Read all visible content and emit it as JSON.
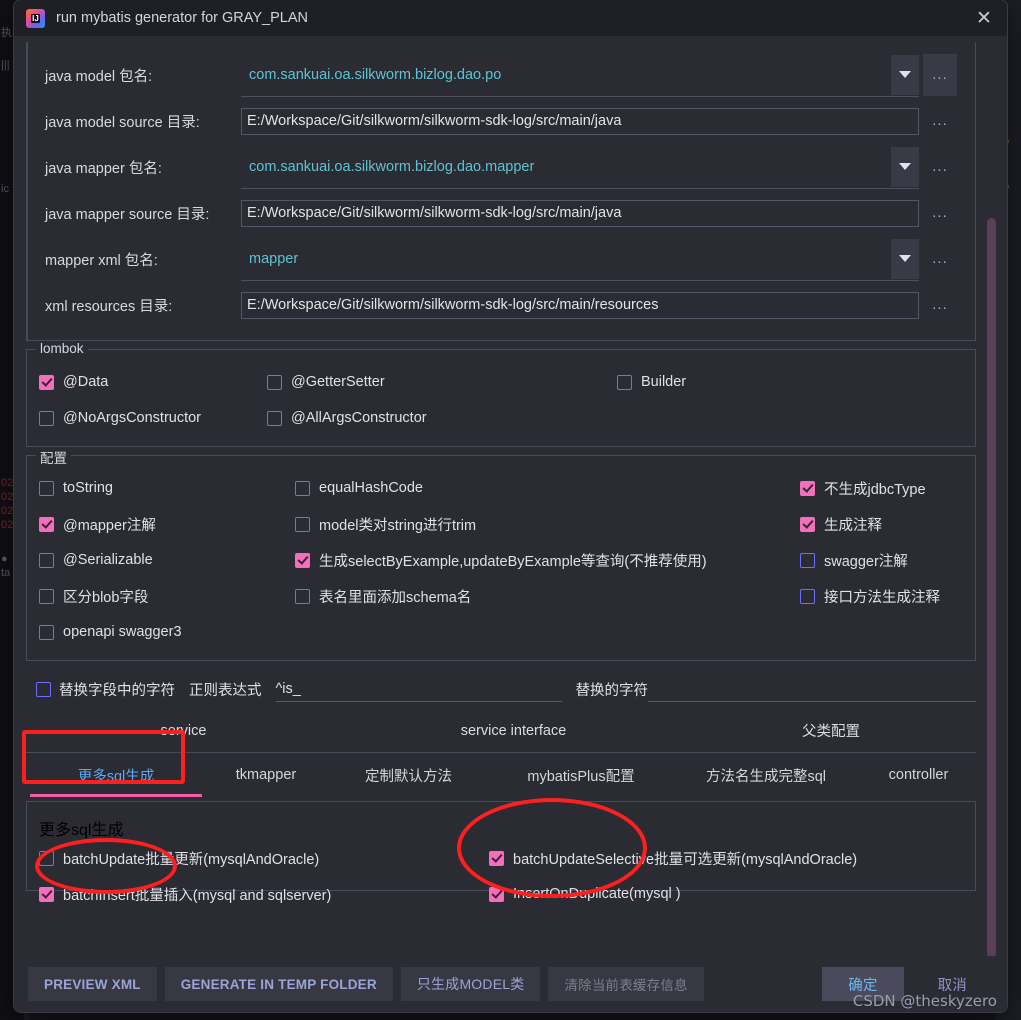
{
  "window": {
    "title": "run mybatis generator for GRAY_PLAN",
    "close_label": "✕",
    "app_icon": "intellij-idea-icon"
  },
  "paths": {
    "rows": [
      {
        "label": "java model 包名:",
        "type": "combo",
        "value": "com.sankuai.oa.silkworm.bizlog.dao.po",
        "browse": "..."
      },
      {
        "label": "java model source 目录:",
        "type": "text",
        "value": "E:/Workspace/Git/silkworm/silkworm-sdk-log/src/main/java",
        "browse": "..."
      },
      {
        "label": "java mapper 包名:",
        "type": "combo",
        "value": "com.sankuai.oa.silkworm.bizlog.dao.mapper",
        "browse": "..."
      },
      {
        "label": "java mapper source 目录:",
        "type": "text",
        "value": "E:/Workspace/Git/silkworm/silkworm-sdk-log/src/main/java",
        "browse": "..."
      },
      {
        "label": "mapper xml 包名:",
        "type": "combo",
        "value": "mapper",
        "browse": "..."
      },
      {
        "label": "xml resources 目录:",
        "type": "text",
        "value": "E:/Workspace/Git/silkworm/silkworm-sdk-log/src/main/resources",
        "browse": "..."
      }
    ]
  },
  "lombok": {
    "legend": "lombok",
    "items": [
      {
        "label": "@Data",
        "checked": true
      },
      {
        "label": "@GetterSetter",
        "checked": false
      },
      {
        "label": "Builder",
        "checked": false
      },
      {
        "label": "@NoArgsConstructor",
        "checked": false
      },
      {
        "label": "@AllArgsConstructor",
        "checked": false
      }
    ]
  },
  "config": {
    "legend": "配置",
    "items": [
      {
        "label": "toString",
        "checked": false
      },
      {
        "label": "equalHashCode",
        "checked": false
      },
      {
        "label": "不生成jdbcType",
        "checked": true
      },
      {
        "label": "@mapper注解",
        "checked": true
      },
      {
        "label": "model类对string进行trim",
        "checked": false
      },
      {
        "label": "生成注释",
        "checked": true
      },
      {
        "label": "@Serializable",
        "checked": false
      },
      {
        "label": "生成selectByExample,updateByExample等查询(不推荐使用)",
        "checked": true
      },
      {
        "label": "swagger注解",
        "checked": false
      },
      {
        "label": "区分blob字段",
        "checked": false
      },
      {
        "label": "表名里面添加schema名",
        "checked": false
      },
      {
        "label": "接口方法生成注释",
        "checked": false
      },
      {
        "label": "openapi swagger3",
        "checked": false
      }
    ]
  },
  "replace": {
    "checkbox_label": "替换字段中的字符",
    "checked": false,
    "regex_label": "正则表达式",
    "regex_value": "^is_",
    "replacement_label": "替换的字符",
    "replacement_value": ""
  },
  "column_headers": {
    "service": "service",
    "service_interface": "service interface",
    "parent_config": "父类配置"
  },
  "tabs": {
    "items": [
      {
        "label": "更多sql生成",
        "active": true
      },
      {
        "label": "tkmapper",
        "active": false
      },
      {
        "label": "定制默认方法",
        "active": false
      },
      {
        "label": "mybatisPlus配置",
        "active": false
      },
      {
        "label": "方法名生成完整sql",
        "active": false
      },
      {
        "label": "controller",
        "active": false
      }
    ]
  },
  "sql_panel": {
    "legend": "更多sql生成",
    "items": [
      {
        "label": "batchUpdate批量更新(mysqlAndOracle)",
        "checked": false
      },
      {
        "label": "batchUpdateSelective批量可选更新(mysqlAndOracle)",
        "checked": true
      },
      {
        "label": "batchInsert批量插入(mysql and sqlserver)",
        "checked": true
      },
      {
        "label": "InsertOnDuplicate(mysql )",
        "checked": true
      }
    ]
  },
  "buttons": {
    "preview_xml": "PREVIEW XML",
    "generate_temp": "GENERATE IN TEMP FOLDER",
    "only_model": "只生成MODEL类",
    "clear_cache": "清除当前表缓存信息",
    "ok": "确定",
    "cancel": "取消"
  },
  "watermark": "CSDN @theskyzero",
  "colors": {
    "accent_checked": "#f36fbb",
    "link_text": "#5fc4d0",
    "tab_active": "#5aaaf5",
    "tab_underline": "#f25ca8",
    "annotation": "#ff1f1f",
    "scrollbar": "#5b3f58",
    "dialog_bg": "#2b2b33",
    "titlebar_bg": "#1f1f26"
  }
}
